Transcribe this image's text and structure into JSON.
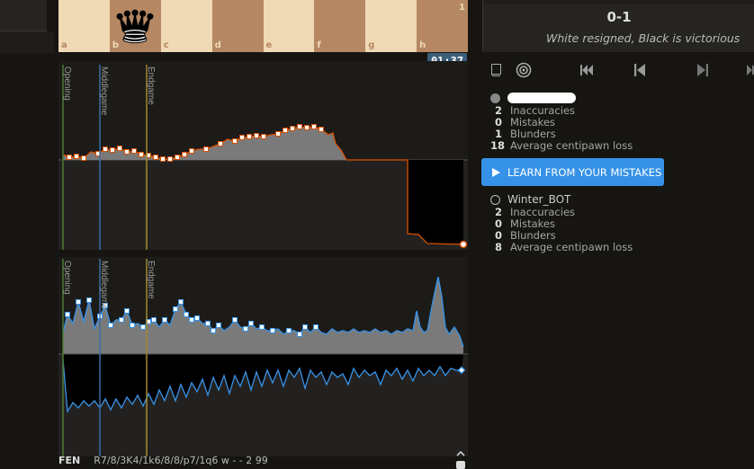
{
  "board": {
    "files": [
      "a",
      "b",
      "c",
      "d",
      "e",
      "f",
      "g",
      "h"
    ],
    "rank_label": "1",
    "queen_on": "b"
  },
  "clock": "01:37",
  "result": {
    "score": "0-1",
    "status": "White resigned, Black is victorious"
  },
  "phase_labels": {
    "opening": "Opening",
    "middlegame": "Middlegame",
    "endgame": "Endgame"
  },
  "controls": [
    "book-icon",
    "target-icon",
    "first-move-icon",
    "prev-move-icon",
    "next-move-icon",
    "last-move-icon"
  ],
  "players": [
    {
      "name": "",
      "name_redacted": true,
      "color": "black",
      "stats": [
        {
          "value": "2",
          "label": "Inaccuracies"
        },
        {
          "value": "0",
          "label": "Mistakes"
        },
        {
          "value": "1",
          "label": "Blunders"
        },
        {
          "value": "18",
          "label": "Average centipawn loss"
        }
      ]
    },
    {
      "name": "Winter_BOT",
      "color": "white",
      "stats": [
        {
          "value": "2",
          "label": "Inaccuracies"
        },
        {
          "value": "0",
          "label": "Mistakes"
        },
        {
          "value": "0",
          "label": "Blunders"
        },
        {
          "value": "8",
          "label": "Average centipawn loss"
        }
      ]
    }
  ],
  "learn_button": "LEARN FROM YOUR MISTAKES",
  "fen": {
    "label": "FEN",
    "value": "R7/8/3K4/1k6/8/8/p7/1q6 w - - 2 99"
  },
  "colors": {
    "accent": "#3692e7",
    "eval_line": "#d85000",
    "time_line": "#3893e8",
    "opening_line": "#4a7a33",
    "middlegame_line": "#3a6ea5",
    "endgame_line": "#a08a30"
  }
}
